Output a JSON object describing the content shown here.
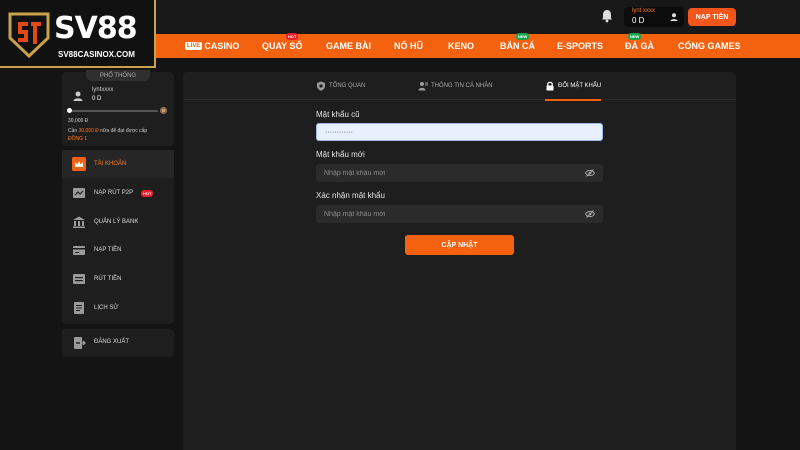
{
  "header": {
    "username": "lynt xxxx",
    "balance": "0 D",
    "deposit_label": "NẠP TIỀN"
  },
  "logo": {
    "brand": "SV88",
    "site": "SV88CASINOX.COM"
  },
  "nav": {
    "live_tag": "LIVE",
    "items": [
      {
        "label": "CASINO",
        "badge": ""
      },
      {
        "label": "QUAY SỐ",
        "badge": "HOT"
      },
      {
        "label": "GAME BÀI",
        "badge": ""
      },
      {
        "label": "NỔ HŨ",
        "badge": ""
      },
      {
        "label": "KENO",
        "badge": ""
      },
      {
        "label": "BẮN CÁ",
        "badge": "NEW"
      },
      {
        "label": "E-SPORTS",
        "badge": ""
      },
      {
        "label": "ĐÁ GÀ",
        "badge": "NEW"
      },
      {
        "label": "CỔNG GAMES",
        "badge": ""
      }
    ]
  },
  "sidebar": {
    "tier": "PHỔ THÔNG",
    "username": "lyntxxxx",
    "balance": "0 D",
    "progress": 0,
    "goal": "30,000 Đ",
    "need_prefix": "Cần",
    "need_amount": "30,000 Đ",
    "need_suffix": "nữa để đạt được cấp",
    "next_tier": "ĐỒNG 1",
    "menu": [
      {
        "label": "TÀI KHOẢN",
        "icon": "crown-icon",
        "active": true
      },
      {
        "label": "NẠP RÚT P2P",
        "icon": "p2p-icon",
        "hot": "HOT"
      },
      {
        "label": "QUẢN LÝ BANK",
        "icon": "bank-icon"
      },
      {
        "label": "NẠP TIỀN",
        "icon": "deposit-icon"
      },
      {
        "label": "RÚT TIỀN",
        "icon": "withdraw-icon"
      },
      {
        "label": "LỊCH SỬ",
        "icon": "history-icon"
      }
    ],
    "logout": "ĐĂNG XUẤT"
  },
  "tabs": [
    {
      "label": "TỔNG QUAN",
      "icon": "shield-icon"
    },
    {
      "label": "THÔNG TIN CÁ NHÂN",
      "icon": "user-card-icon"
    },
    {
      "label": "ĐỔI MẬT KHẨU",
      "icon": "lock-icon",
      "active": true
    }
  ],
  "form": {
    "old_password_label": "Mật khẩu cũ",
    "old_password_value": "············",
    "new_password_label": "Mật khẩu mới",
    "new_password_placeholder": "Nhập mật khẩu mới",
    "confirm_password_label": "Xác nhận mật khẩu",
    "confirm_password_placeholder": "Nhập mật khẩu mới",
    "submit_label": "CẬP NHẬT"
  },
  "colors": {
    "accent": "#f5620f",
    "highlight": "#ff7a1a",
    "panel": "#1e1e1e",
    "background": "#141414"
  }
}
